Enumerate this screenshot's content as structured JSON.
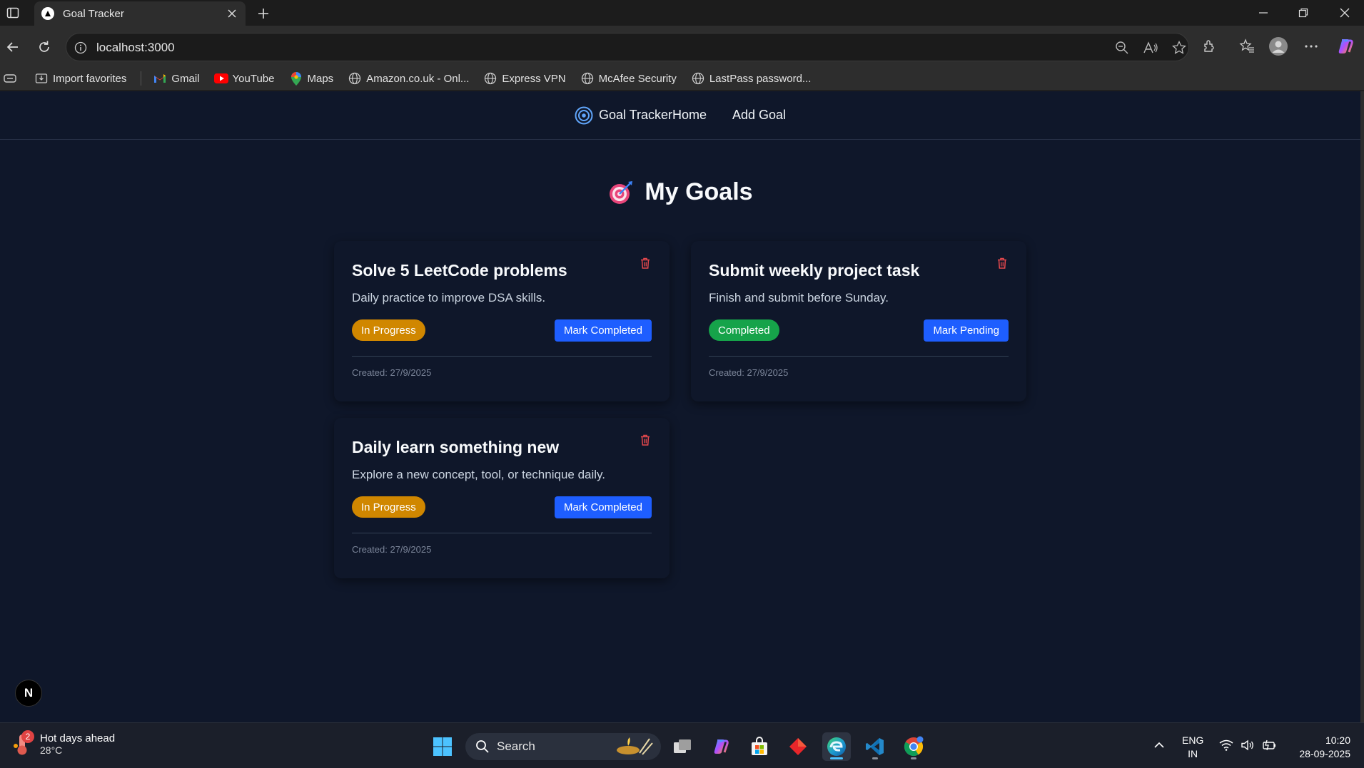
{
  "browser": {
    "tab_title": "Goal Tracker",
    "url": "localhost:3000",
    "bookmarks": [
      {
        "label": "Import favorites",
        "icon": "import-icon"
      },
      {
        "label": "Gmail",
        "icon": "gmail-icon"
      },
      {
        "label": "YouTube",
        "icon": "youtube-icon"
      },
      {
        "label": "Maps",
        "icon": "maps-icon"
      },
      {
        "label": "Amazon.co.uk - Onl...",
        "icon": "globe-icon"
      },
      {
        "label": "Express VPN",
        "icon": "globe-icon"
      },
      {
        "label": "McAfee Security",
        "icon": "globe-icon"
      },
      {
        "label": "LastPass password...",
        "icon": "globe-icon"
      }
    ]
  },
  "navbar": {
    "brand": "Goal Tracker",
    "home": "Home",
    "add_goal": "Add Goal"
  },
  "page": {
    "heading": "My Goals"
  },
  "goals": [
    {
      "title": "Solve 5 LeetCode problems",
      "description": "Daily practice to improve DSA skills.",
      "status": "In Progress",
      "action": "Mark Completed",
      "created": "Created: 27/9/2025"
    },
    {
      "title": "Submit weekly project task",
      "description": "Finish and submit before Sunday.",
      "status": "Completed",
      "action": "Mark Pending",
      "created": "Created: 27/9/2025"
    },
    {
      "title": "Daily learn something new",
      "description": "Explore a new concept, tool, or technique daily.",
      "status": "In Progress",
      "action": "Mark Completed",
      "created": "Created: 27/9/2025"
    }
  ],
  "nextjs_badge": "N",
  "taskbar": {
    "weather_title": "Hot days ahead",
    "weather_temp": "28°C",
    "weather_badge": "2",
    "search": "Search",
    "lang_top": "ENG",
    "lang_bottom": "IN",
    "time": "10:20",
    "date": "28-09-2025"
  },
  "colors": {
    "page_bg": "#0f172a",
    "in_progress": "#d08700",
    "completed": "#16a34a",
    "primary_button": "#1e5eff",
    "delete": "#e5484d"
  }
}
